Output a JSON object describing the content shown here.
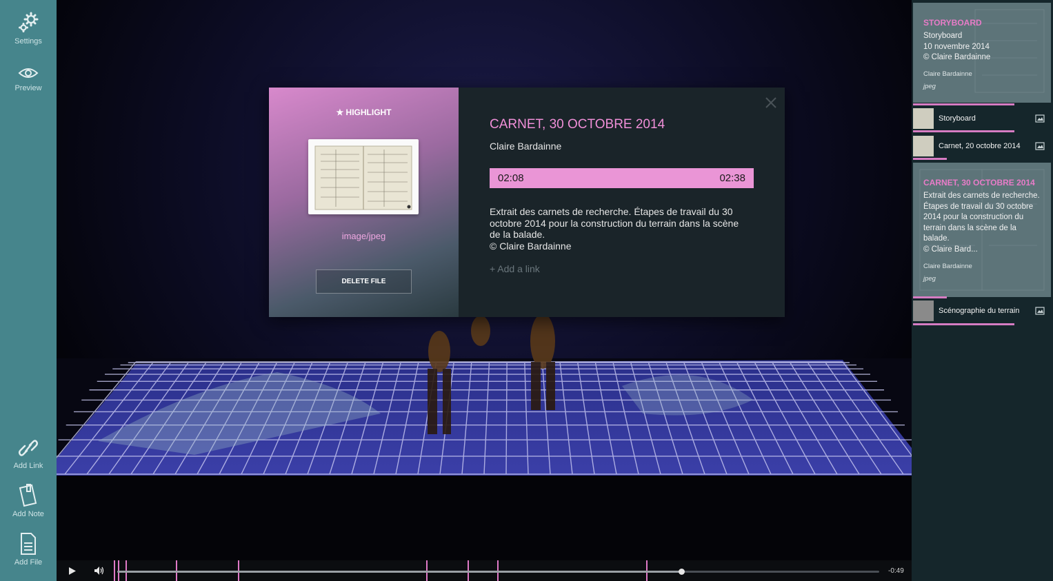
{
  "sidebar": {
    "top_items": [
      {
        "label": "Settings",
        "icon": "gear-icon"
      },
      {
        "label": "Preview",
        "icon": "eye-icon"
      }
    ],
    "bottom_items": [
      {
        "label": "Add Link",
        "icon": "link-icon"
      },
      {
        "label": "Add Note",
        "icon": "note-icon"
      },
      {
        "label": "Add File",
        "icon": "file-icon"
      }
    ]
  },
  "player": {
    "time_remaining": "-0:49",
    "progress": 0.74,
    "play_icon": "play-icon",
    "volume_icon": "volume-icon"
  },
  "modal": {
    "highlight_label": "★ HIGHLIGHT",
    "mime_type": "image/jpeg",
    "delete_label": "DELETE FILE",
    "title": "CARNET, 30 OCTOBRE 2014",
    "author": "Claire Bardainne",
    "start_time": "02:08",
    "end_time": "02:38",
    "description": "Extrait des carnets de recherche. Étapes de travail du 30\noctobre 2014 pour la construction du terrain dans la scène\nde la balade.\n© Claire Bardainne",
    "add_link": "+ Add a link"
  },
  "right_panel": {
    "card_storyboard": {
      "title": "STORYBOARD",
      "text": "Storyboard\n10 novembre 2014\n© Claire Bardainne",
      "author": "Claire Bardainne",
      "type": "jpeg"
    },
    "list_items": [
      {
        "label": "Storyboard",
        "icon": "image-icon"
      },
      {
        "label": "Carnet, 20 octobre 2014",
        "icon": "image-icon"
      },
      {
        "label": "Scénographie du terrain",
        "icon": "image-icon"
      }
    ],
    "card_carnet": {
      "title": "CARNET, 30 OCTOBRE 2014",
      "text": "Extrait des carnets de recherche.\nÉtapes de travail du 30 octobre\n2014 pour la construction du\nterrain dans la scène de la\nbalade.\n© Claire Bard...",
      "author": "Claire Bardainne",
      "type": "jpeg"
    }
  },
  "colors": {
    "sidebar": "#46858c",
    "accent_pink": "#ea95d6",
    "modal_bg": "#1a2429",
    "panel_bg": "#15262b"
  }
}
